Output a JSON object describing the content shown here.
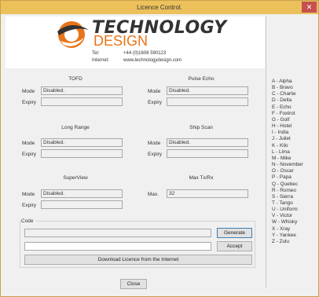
{
  "window": {
    "title": "Licence Control.",
    "close_glyph": "✕"
  },
  "logo": {
    "word1": "TECHNOLOGY",
    "word2": "DESIGN",
    "tel_label": "Tel:",
    "tel": "+44 (0)1606 590123",
    "web_label": "Internet:",
    "web": "www.technologydesign.com"
  },
  "labels": {
    "mode": "Mode",
    "expiry": "Expiry",
    "max": "Max."
  },
  "groups": {
    "tofd": {
      "title": "TOFD",
      "mode": "Disabled.",
      "expiry": ""
    },
    "pulse_echo": {
      "title": "Pulse Echo",
      "mode": "Disabled.",
      "expiry": ""
    },
    "long_range": {
      "title": "Long Range",
      "mode": "Disabled.",
      "expiry": ""
    },
    "ship_scan": {
      "title": "Ship Scan",
      "mode": "Disabled.",
      "expiry": ""
    },
    "super_view": {
      "title": "SuperView",
      "mode": "Disabled.",
      "expiry": ""
    },
    "max_txrx": {
      "title": "Max Tx/Rx",
      "max": "32"
    }
  },
  "code": {
    "title": "Code",
    "value": "",
    "input_value": "",
    "generate": "Generate",
    "accept": "Accept",
    "download": "Download Licence from the Internet"
  },
  "close_button": "Close",
  "phonetic": [
    "A - Alpha",
    "B - Bravo",
    "C - Charlie",
    "D - Delta",
    "E - Echo",
    "F - Foxtrot",
    "G - Golf",
    "H - Hotel",
    "I - India",
    "J - Juliet",
    "K - Kilo",
    "L - Lima",
    "M - Mike",
    "N - November",
    "O - Oscar",
    "P - Papa",
    "Q - Quebec",
    "R - Romeo",
    "S - Sierra",
    "T - Tango",
    "U - Uniform",
    "V - Victor",
    "W - Whisky",
    "X - Xray",
    "Y - Yankee",
    "Z - Zulu"
  ],
  "colors": {
    "titlebar": "#ecc15c",
    "close": "#c75050",
    "brand_orange": "#e8751a",
    "brand_dark": "#333333"
  }
}
